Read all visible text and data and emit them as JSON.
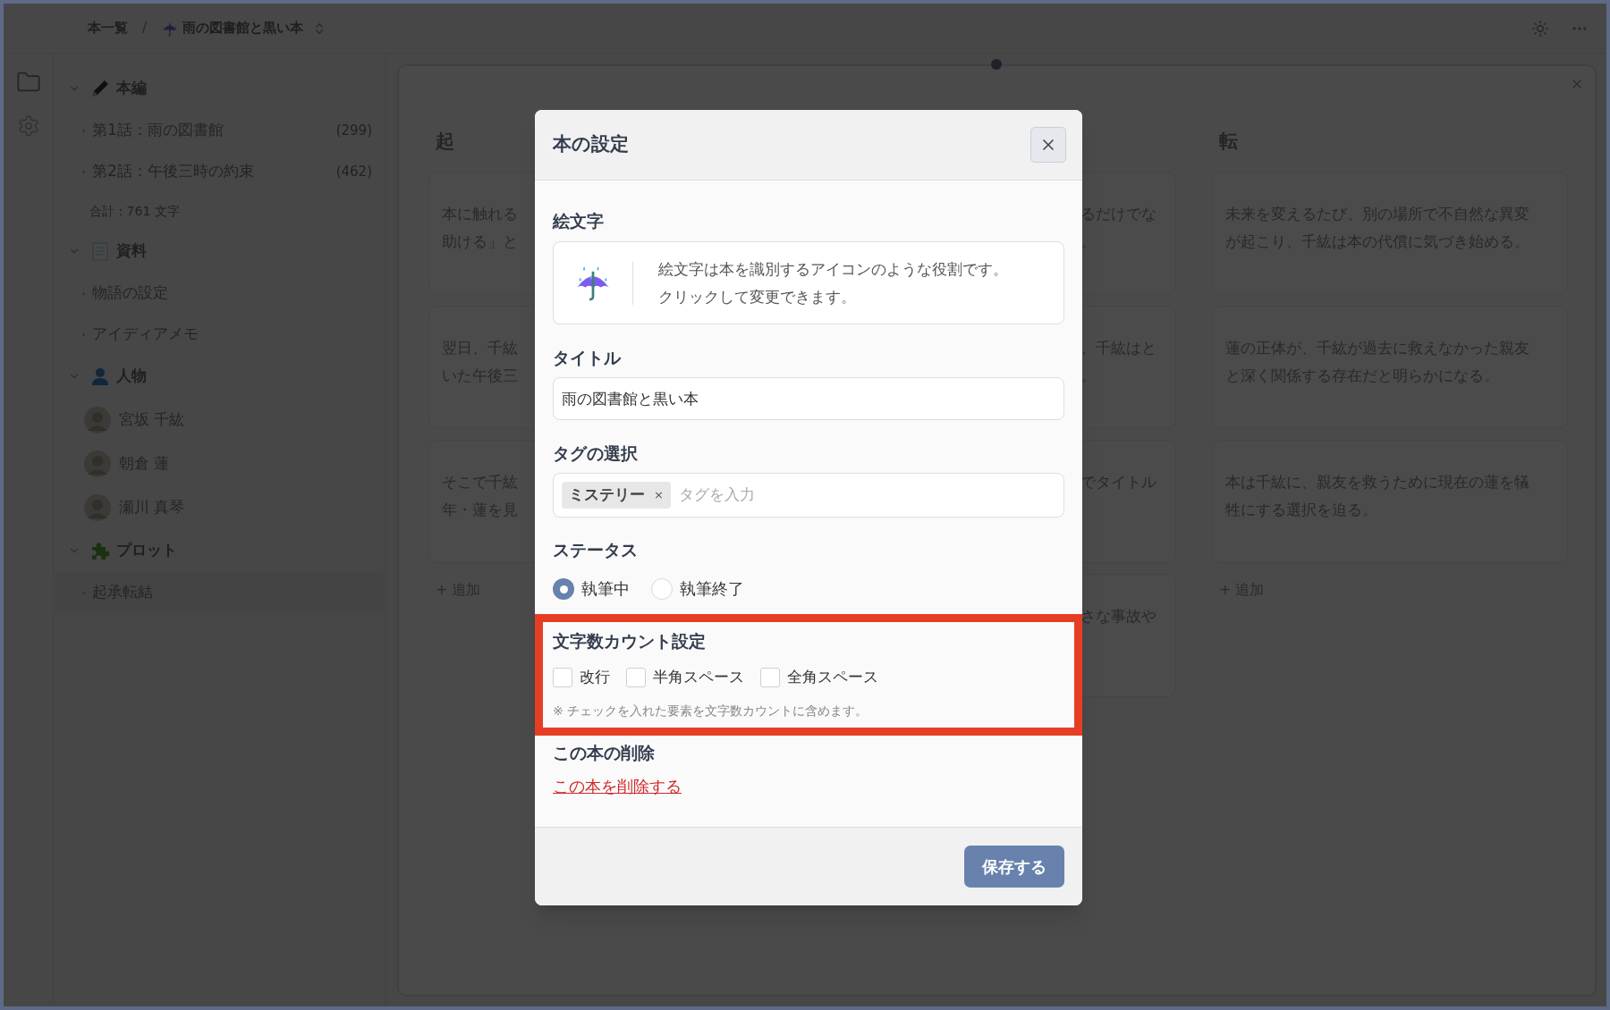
{
  "breadcrumb": {
    "root": "本一覧",
    "separator": "/",
    "book_title": "雨の図書館と黒い本"
  },
  "sidebar": {
    "sections": [
      {
        "kind": "manuscript",
        "title": "本編",
        "expanded": true,
        "children": [
          {
            "kind": "chapter",
            "label": "第1話：雨の図書館",
            "count": "(299)",
            "selected": false
          },
          {
            "kind": "chapter",
            "label": "第2話：午後三時の約束",
            "count": "(462)",
            "selected": false
          }
        ],
        "total": "合計 : 761 文字"
      },
      {
        "kind": "materials",
        "title": "資料",
        "expanded": true,
        "children": [
          {
            "kind": "doc",
            "label": "物語の設定",
            "selected": false
          },
          {
            "kind": "doc",
            "label": "アイディアメモ",
            "selected": false
          }
        ]
      },
      {
        "kind": "characters",
        "title": "人物",
        "expanded": true,
        "children": [
          {
            "kind": "person",
            "label": "宮坂 千紘",
            "selected": false
          },
          {
            "kind": "person",
            "label": "朝倉 蓮",
            "selected": false
          },
          {
            "kind": "person",
            "label": "瀬川 真琴",
            "selected": false
          }
        ]
      },
      {
        "kind": "plot",
        "title": "プロット",
        "expanded": true,
        "children": [
          {
            "kind": "doc",
            "label": "起承転結",
            "selected": true
          }
        ]
      }
    ]
  },
  "board": {
    "columns": [
      {
        "kind": "left_visible",
        "title": "起",
        "cards": [
          {
            "lines": [
              "本に触れる",
              "助ける」と"
            ]
          },
          {
            "lines": [
              "翌日、千紘",
              "いた午後三"
            ]
          },
          {
            "lines": [
              "そこで千紘",
              "年・蓮を見"
            ]
          }
        ],
        "add_label": "+ 追加"
      },
      {
        "kind": "right_visible",
        "cards": [
          {
            "lines": [
              "るだけでな",
              "。"
            ]
          },
          {
            "lines": [
              "、千紘はと",
              "。"
            ]
          },
          {
            "lines": [
              "でタイトル"
            ]
          },
          {
            "lines": [
              "さな事故や"
            ]
          }
        ]
      },
      {
        "kind": "full",
        "title": "転",
        "cards": [
          {
            "lines": [
              "未来を変えるたび、別の場所で不自然な異変",
              "が起こり、千紘は本の代償に気づき始める。"
            ]
          },
          {
            "lines": [
              "蓮の正体が、千紘が過去に救えなかった親友",
              "と深く関係する存在だと明らかになる。"
            ]
          },
          {
            "lines": [
              "本は千紘に、親友を救うために現在の蓮を犠",
              "牲にする選択を迫る。"
            ]
          }
        ],
        "add_label": "+ 追加"
      }
    ]
  },
  "dialog": {
    "title": "本の設定",
    "emoji": {
      "label": "絵文字",
      "description": [
        "絵文字は本を識別するアイコンのような役割です。",
        "クリックして変更できます。"
      ]
    },
    "title_field": {
      "label": "タイトル",
      "value": "雨の図書館と黒い本"
    },
    "tags": {
      "label": "タグの選択",
      "tags": [
        {
          "label": "ミステリー",
          "remove": "×"
        }
      ],
      "placeholder": "タグを入力"
    },
    "status": {
      "label": "ステータス",
      "options": [
        {
          "label": "執筆中",
          "selected": true
        },
        {
          "label": "執筆終了",
          "selected": false
        }
      ]
    },
    "count_settings": {
      "label": "文字数カウント設定",
      "highlighted": true,
      "options": [
        {
          "label": "改行",
          "checked": false
        },
        {
          "label": "半角スペース",
          "checked": false
        },
        {
          "label": "全角スペース",
          "checked": false
        }
      ],
      "note": "※ チェックを入れた要素を文字数カウントに含めます。"
    },
    "delete": {
      "label": "この本の削除",
      "link": "この本を削除する"
    },
    "save_button": "保存する"
  }
}
